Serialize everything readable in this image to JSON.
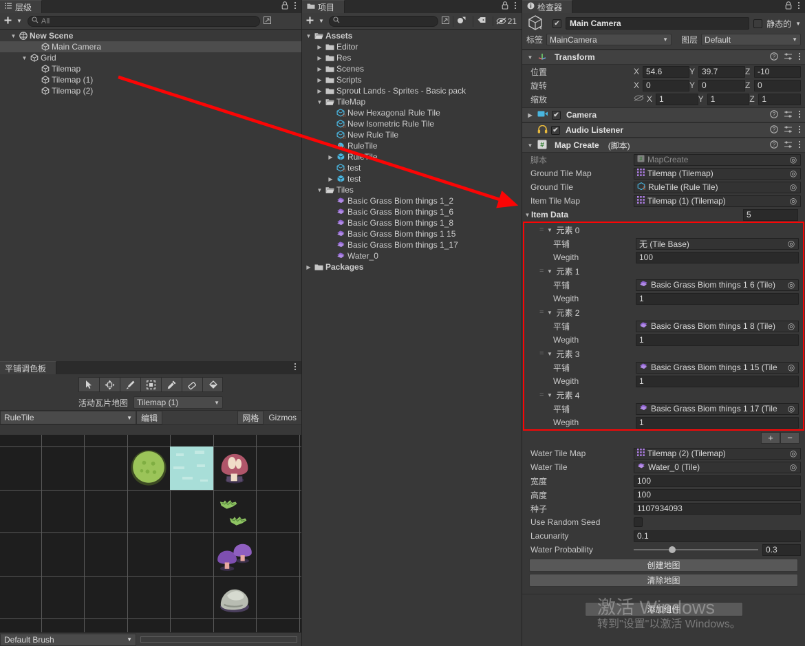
{
  "hierarchy": {
    "tab_label": "层级",
    "search_placeholder": "All",
    "add_label": "+",
    "items": [
      {
        "label": "New Scene",
        "depth": 0,
        "arrow": "down",
        "icon": "scene-icon",
        "bold": true,
        "selected": false
      },
      {
        "label": "Main Camera",
        "depth": 2,
        "arrow": "none",
        "icon": "cube-icon",
        "bold": false,
        "selected": true
      },
      {
        "label": "Grid",
        "depth": 1,
        "arrow": "down",
        "icon": "cube-icon",
        "bold": false,
        "selected": false
      },
      {
        "label": "Tilemap",
        "depth": 2,
        "arrow": "none",
        "icon": "cube-icon",
        "bold": false,
        "selected": false
      },
      {
        "label": "Tilemap (1)",
        "depth": 2,
        "arrow": "none",
        "icon": "cube-icon",
        "bold": false,
        "selected": false
      },
      {
        "label": "Tilemap (2)",
        "depth": 2,
        "arrow": "none",
        "icon": "cube-icon",
        "bold": false,
        "selected": false
      }
    ]
  },
  "project": {
    "tab_label": "项目",
    "search_placeholder": "",
    "hidden_count": "21",
    "items": [
      {
        "label": "Assets",
        "depth": 0,
        "arrow": "down",
        "icon": "folder-open-icon",
        "bold": true
      },
      {
        "label": "Editor",
        "depth": 1,
        "arrow": "right",
        "icon": "folder-icon",
        "bold": false
      },
      {
        "label": "Res",
        "depth": 1,
        "arrow": "right",
        "icon": "folder-icon",
        "bold": false
      },
      {
        "label": "Scenes",
        "depth": 1,
        "arrow": "right",
        "icon": "folder-icon",
        "bold": false
      },
      {
        "label": "Scripts",
        "depth": 1,
        "arrow": "right",
        "icon": "folder-icon",
        "bold": false
      },
      {
        "label": "Sprout Lands - Sprites - Basic pack",
        "depth": 1,
        "arrow": "right",
        "icon": "folder-icon",
        "bold": false
      },
      {
        "label": "TileMap",
        "depth": 1,
        "arrow": "down",
        "icon": "folder-open-icon",
        "bold": false
      },
      {
        "label": "New Hexagonal Rule Tile",
        "depth": 2,
        "arrow": "none",
        "icon": "rule-tile-icon",
        "bold": false
      },
      {
        "label": "New Isometric Rule Tile",
        "depth": 2,
        "arrow": "none",
        "icon": "rule-tile-icon",
        "bold": false
      },
      {
        "label": "New Rule Tile",
        "depth": 2,
        "arrow": "none",
        "icon": "rule-tile-icon",
        "bold": false
      },
      {
        "label": "RuleTile",
        "depth": 2,
        "arrow": "none",
        "icon": "script-tile-icon",
        "bold": false
      },
      {
        "label": "RuleTile",
        "depth": 2,
        "arrow": "right",
        "icon": "prefab-icon",
        "bold": false
      },
      {
        "label": "test",
        "depth": 2,
        "arrow": "none",
        "icon": "rule-tile-icon",
        "bold": false
      },
      {
        "label": "test",
        "depth": 2,
        "arrow": "right",
        "icon": "prefab-icon",
        "bold": false
      },
      {
        "label": "Tiles",
        "depth": 1,
        "arrow": "down",
        "icon": "folder-open-icon",
        "bold": false
      },
      {
        "label": "Basic Grass Biom things 1_2",
        "depth": 2,
        "arrow": "none",
        "icon": "tile-icon",
        "bold": false
      },
      {
        "label": "Basic Grass Biom things 1_6",
        "depth": 2,
        "arrow": "none",
        "icon": "tile-icon",
        "bold": false
      },
      {
        "label": "Basic Grass Biom things 1_8",
        "depth": 2,
        "arrow": "none",
        "icon": "tile-icon",
        "bold": false
      },
      {
        "label": "Basic Grass Biom things 1 15",
        "depth": 2,
        "arrow": "none",
        "icon": "tile-icon",
        "bold": false
      },
      {
        "label": "Basic Grass Biom things 1_17",
        "depth": 2,
        "arrow": "none",
        "icon": "tile-icon",
        "bold": false
      },
      {
        "label": "Water_0",
        "depth": 2,
        "arrow": "none",
        "icon": "tile-icon",
        "bold": false
      },
      {
        "label": "Packages",
        "depth": 0,
        "arrow": "right",
        "icon": "folder-icon",
        "bold": true
      }
    ]
  },
  "inspector": {
    "tab_label": "检查器",
    "object_name": "Main Camera",
    "static_label": "静态的",
    "tag_label": "标签",
    "tag_value": "MainCamera",
    "layer_label": "图层",
    "layer_value": "Default",
    "transform": {
      "title": "Transform",
      "position_label": "位置",
      "rotation_label": "旋转",
      "scale_label": "缩放",
      "position": {
        "x": "54.6",
        "y": "39.7",
        "z": "-10"
      },
      "rotation": {
        "x": "0",
        "y": "0",
        "z": "0"
      },
      "scale": {
        "x": "1",
        "y": "1",
        "z": "1"
      },
      "axis_x": "X",
      "axis_y": "Y",
      "axis_z": "Z"
    },
    "camera_component": "Camera",
    "audio_component": "Audio Listener",
    "map_create": {
      "title": "Map Create",
      "suffix": "(脚本)",
      "script_label": "脚本",
      "script_value": "MapCreate",
      "ground_tile_map_label": "Ground Tile Map",
      "ground_tile_map_value": "Tilemap (Tilemap)",
      "ground_tile_label": "Ground Tile",
      "ground_tile_value": "RuleTile (Rule Tile)",
      "item_tile_map_label": "Item Tile Map",
      "item_tile_map_value": "Tilemap (1) (Tilemap)",
      "item_data_label": "Item Data",
      "item_data_count": "5",
      "tile_label": "平铺",
      "weight_label": "Wegith",
      "elements": [
        {
          "name": "元素 0",
          "tile": "无 (Tile Base)",
          "tile_has_icon": false,
          "weight": "100"
        },
        {
          "name": "元素 1",
          "tile": "Basic Grass Biom things 1 6 (Tile)",
          "tile_has_icon": true,
          "weight": "1"
        },
        {
          "name": "元素 2",
          "tile": "Basic Grass Biom things 1 8 (Tile)",
          "tile_has_icon": true,
          "weight": "1"
        },
        {
          "name": "元素 3",
          "tile": "Basic Grass Biom things 1 15 (Tile",
          "tile_has_icon": true,
          "weight": "1"
        },
        {
          "name": "元素 4",
          "tile": "Basic Grass Biom things 1 17 (Tile",
          "tile_has_icon": true,
          "weight": "1"
        }
      ],
      "add_element": "+",
      "remove_element": "−",
      "water_tile_map_label": "Water Tile Map",
      "water_tile_map_value": "Tilemap (2) (Tilemap)",
      "water_tile_label": "Water Tile",
      "water_tile_value": "Water_0 (Tile)",
      "width_label": "宽度",
      "width_value": "100",
      "height_label": "高度",
      "height_value": "100",
      "seed_label": "种子",
      "seed_value": "1107934093",
      "use_random_seed_label": "Use Random Seed",
      "lacunarity_label": "Lacunarity",
      "lacunarity_value": "0.1",
      "water_probability_label": "Water Probability",
      "water_probability_value": "0.3",
      "create_map_button": "创建地图",
      "clear_map_button": "清除地图"
    },
    "add_component_button": "添加组件"
  },
  "palette": {
    "tab_label": "平铺调色板",
    "tools": [
      "select-tool",
      "move-tool",
      "brush-tool",
      "box-tool",
      "picker-tool",
      "eraser-tool",
      "fill-tool"
    ],
    "active_tilemap_label": "活动瓦片地图",
    "active_tilemap_value": "Tilemap (1)",
    "palette_value": "RuleTile",
    "edit_label": "编辑",
    "grid_label": "网格",
    "gizmos_label": "Gizmos",
    "default_brush": "Default Brush",
    "tiles": [
      {
        "name": "grass-bush-tile",
        "col": 3,
        "row": 1,
        "kind": "bush"
      },
      {
        "name": "water-tile",
        "col": 4,
        "row": 1,
        "kind": "water"
      },
      {
        "name": "pink-mushroom-tile",
        "col": 5,
        "row": 1,
        "kind": "pinkmush"
      },
      {
        "name": "green-leaf-tile-a",
        "col": 5,
        "row": 2,
        "kind": "leafA"
      },
      {
        "name": "green-leaf-tile-b",
        "col": 5,
        "row": 2,
        "kind": "leafB"
      },
      {
        "name": "purple-mushroom-tile",
        "col": 5,
        "row": 3,
        "kind": "purplemush"
      },
      {
        "name": "rock-tile",
        "col": 5,
        "row": 4,
        "kind": "rock"
      }
    ]
  },
  "watermark": {
    "line1": "激活 Windows",
    "line2": "转到\"设置\"以激活 Windows。"
  },
  "colors": {
    "accent_red": "#fb0505",
    "panel_bg": "#383838",
    "header_bg": "#3c3c3c",
    "field_bg": "#2a2a2a",
    "selected_row": "#4d4d4d"
  }
}
